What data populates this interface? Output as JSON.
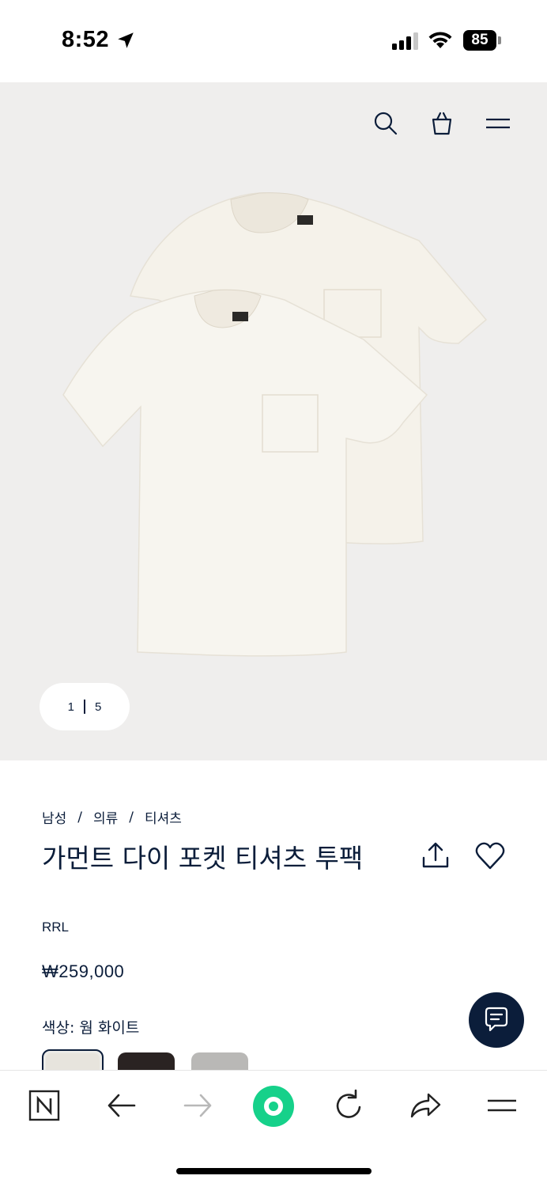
{
  "status_bar": {
    "time": "8:52",
    "battery": "85"
  },
  "hero": {
    "image_counter": {
      "current": "1",
      "total": "5"
    },
    "header_icons": [
      "search-icon",
      "shopping-bag-icon",
      "menu-icon"
    ]
  },
  "product": {
    "breadcrumb": [
      "남성",
      "의류",
      "티셔츠"
    ],
    "breadcrumb_separator": "/",
    "title": "가먼트 다이 포켓 티셔츠 투팩",
    "brand": "RRL",
    "price": "₩259,000",
    "color_label": "색상: 웜 화이트",
    "swatches": [
      {
        "name": "웜 화이트",
        "color": "#e7e4dd",
        "selected": true
      },
      {
        "name": "black",
        "color": "#2a2322",
        "selected": false
      },
      {
        "name": "grey",
        "color": "#b9b8b6",
        "selected": false
      }
    ]
  },
  "colors": {
    "navy": "#0b1d3a",
    "hero_bg": "#efeeed",
    "accent_green": "#16d18a"
  },
  "toolbar": {
    "icons": [
      "naver-n-icon",
      "back-arrow-icon",
      "forward-arrow-icon",
      "green-dot-icon",
      "reload-icon",
      "share-arrow-icon",
      "menu-icon"
    ]
  }
}
